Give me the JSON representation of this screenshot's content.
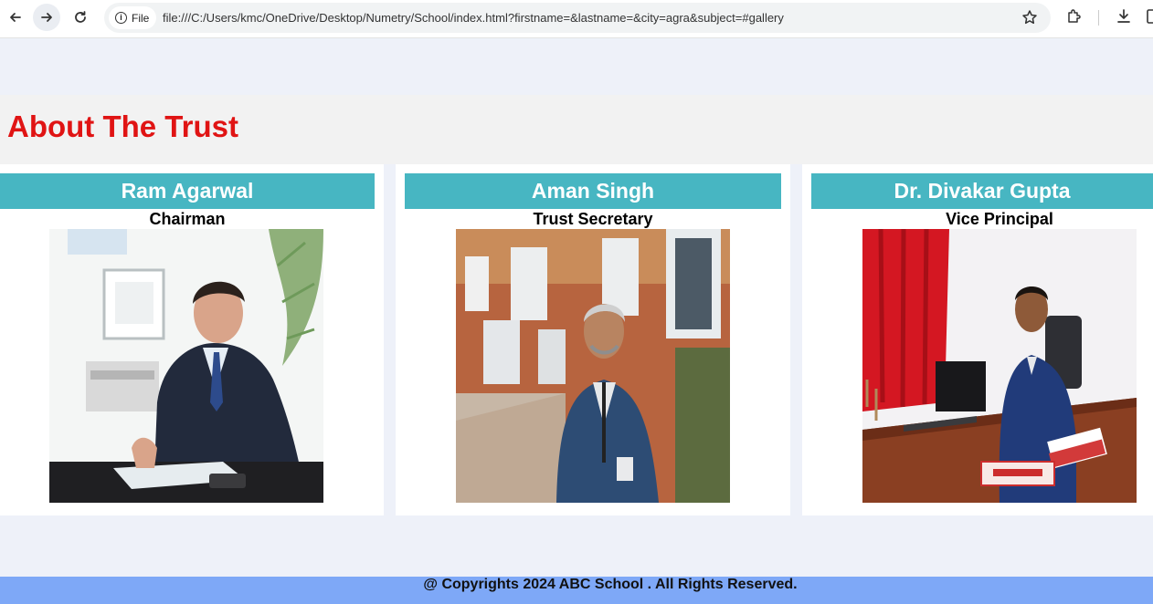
{
  "browser": {
    "site_chip_label": "File",
    "url": "file:///C:/Users/kmc/OneDrive/Desktop/Numetry/School/index.html?firstname=&lastname=&city=agra&subject=#gallery"
  },
  "section": {
    "title": "About The Trust"
  },
  "members": [
    {
      "name": "Ram Agarwal",
      "role": "Chairman"
    },
    {
      "name": "Aman Singh",
      "role": "Trust Secretary"
    },
    {
      "name": "Dr. Divakar Gupta",
      "role": "Vice Principal"
    }
  ],
  "footer": {
    "text": "@ Copyrights 2024 ABC School . All Rights Reserved."
  },
  "colors": {
    "title_red": "#e01414",
    "name_bar_teal": "#47b6c2",
    "footer_blue": "#7ea8f7",
    "page_bg": "#eef1f9"
  }
}
